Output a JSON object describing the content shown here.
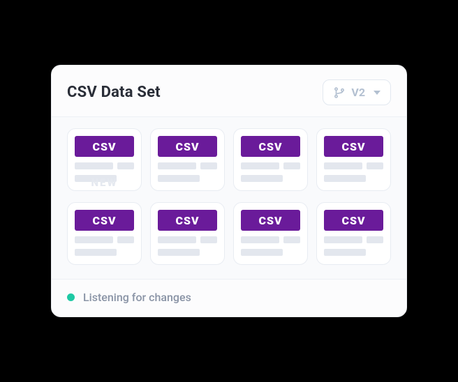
{
  "header": {
    "title": "CSV Data Set",
    "version_label": "V2"
  },
  "file_badge": "CSV",
  "new_label": "NEW",
  "items": [
    {
      "type": "CSV",
      "is_new": true
    },
    {
      "type": "CSV",
      "is_new": false
    },
    {
      "type": "CSV",
      "is_new": false
    },
    {
      "type": "CSV",
      "is_new": false
    },
    {
      "type": "CSV",
      "is_new": false
    },
    {
      "type": "CSV",
      "is_new": false
    },
    {
      "type": "CSV",
      "is_new": false
    },
    {
      "type": "CSV",
      "is_new": false
    }
  ],
  "footer": {
    "status_text": "Listening for changes",
    "status_color": "#1ec9a4"
  }
}
